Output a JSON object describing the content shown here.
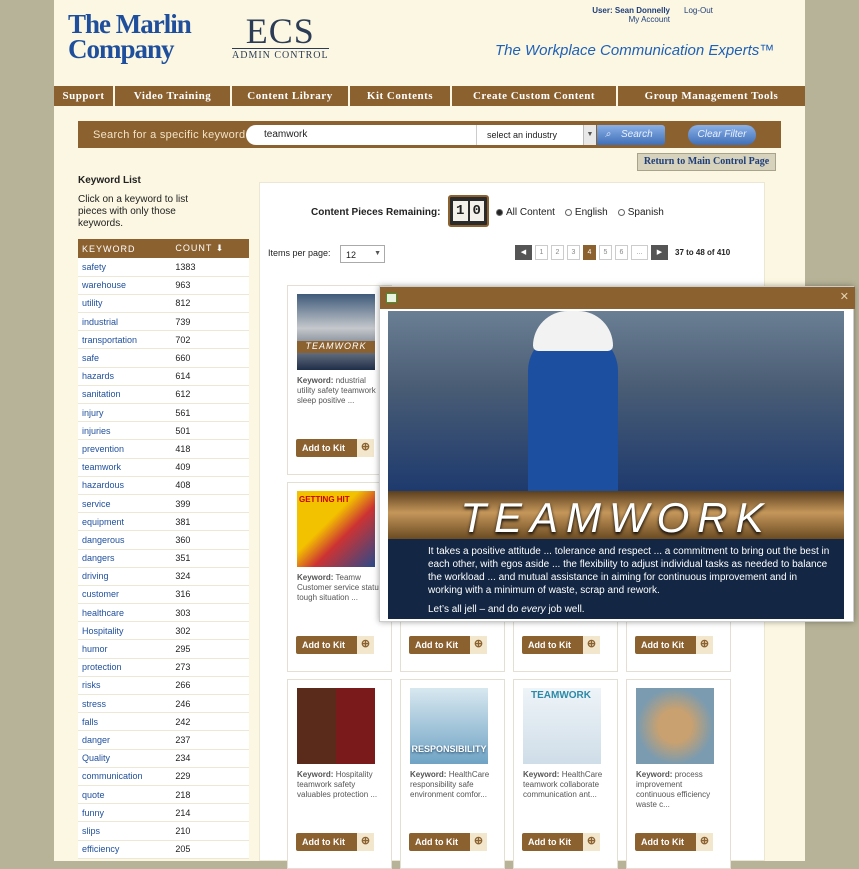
{
  "header": {
    "logo_marlin_line1": "The Marlin",
    "logo_marlin_line2": "Company",
    "logo_ecs": "ECS",
    "logo_ecs_sub": "ADMIN CONTROL",
    "user_label": "User: Sean Donnelly",
    "my_account": "My Account",
    "logout": "Log-Out",
    "tagline": "The Workplace Communication Experts™"
  },
  "nav": [
    "Support",
    "Video Training",
    "Content Library",
    "Kit Contents",
    "Create Custom Content",
    "Group Management Tools"
  ],
  "search": {
    "label": "Search for a specific keyword",
    "value": "teamwork",
    "industry": "select an industry",
    "search_button": "Search",
    "clear_button": "Clear Filter"
  },
  "return_button": "Return to Main Control Page",
  "keywords": {
    "title": "Keyword List",
    "description": "Click on a keyword to list pieces with only those keywords.",
    "col_keyword": "KEYWORD",
    "col_count": "COUNT ⬇",
    "rows": [
      [
        "safety",
        "1383"
      ],
      [
        "warehouse",
        "963"
      ],
      [
        "utility",
        "812"
      ],
      [
        "industrial",
        "739"
      ],
      [
        "transportation",
        "702"
      ],
      [
        "safe",
        "660"
      ],
      [
        "hazards",
        "614"
      ],
      [
        "sanitation",
        "612"
      ],
      [
        "injury",
        "561"
      ],
      [
        "injuries",
        "501"
      ],
      [
        "prevention",
        "418"
      ],
      [
        "teamwork",
        "409"
      ],
      [
        "hazardous",
        "408"
      ],
      [
        "service",
        "399"
      ],
      [
        "equipment",
        "381"
      ],
      [
        "dangerous",
        "360"
      ],
      [
        "dangers",
        "351"
      ],
      [
        "driving",
        "324"
      ],
      [
        "customer",
        "316"
      ],
      [
        "healthcare",
        "303"
      ],
      [
        "Hospitality",
        "302"
      ],
      [
        "humor",
        "295"
      ],
      [
        "protection",
        "273"
      ],
      [
        "risks",
        "266"
      ],
      [
        "stress",
        "246"
      ],
      [
        "falls",
        "242"
      ],
      [
        "danger",
        "237"
      ],
      [
        "Quality",
        "234"
      ],
      [
        "communication",
        "229"
      ],
      [
        "quote",
        "218"
      ],
      [
        "funny",
        "214"
      ],
      [
        "slips",
        "210"
      ],
      [
        "efficiency",
        "205"
      ]
    ]
  },
  "content": {
    "remaining_label": "Content Pieces Remaining:",
    "remaining_digits": [
      "1",
      "0"
    ],
    "filters": [
      "All Content",
      "English",
      "Spanish"
    ],
    "items_per_page_label": "Items per page:",
    "items_per_page": "12",
    "pages": [
      "1",
      "2",
      "3",
      "4",
      "5",
      "6",
      "..."
    ],
    "range_from": "37",
    "range_to": "to 48",
    "range_total": "of 410",
    "add_label": "Add to Kit",
    "keyword_label": "Keyword:",
    "cards": [
      {
        "title": "TEAMWORK",
        "keywords": "ndustrial utility safety teamwork sleep positive ..."
      },
      {
        "title": "GETTING HIT",
        "keywords": "Teamw Customer service status tough situation ..."
      },
      {
        "title": "",
        "keywords": ""
      },
      {
        "title": "",
        "keywords": ""
      },
      {
        "title": "",
        "keywords": ""
      },
      {
        "title": "",
        "keywords": ""
      },
      {
        "title": "",
        "keywords": "Hospitality teamwork safety valuables protection ..."
      },
      {
        "title": "RESPONSIBILITY",
        "keywords": "HealthCare responsibility safe environment comfor..."
      },
      {
        "title": "TEAMWORK",
        "keywords": "HealthCare teamwork collaborate communication ant..."
      },
      {
        "title": "",
        "keywords": "process improvement continuous efficiency waste c..."
      }
    ]
  },
  "popup": {
    "title": "TEAMWORK",
    "body": "It takes a positive attitude ... tolerance and respect ... a commitment to bring out the best in each other, with egos aside ... the flexibility to adjust individual tasks as needed to balance the workload ... and mutual assistance in aiming for continuous improvement and in working with a minimum of waste, scrap and rework.",
    "closing_pre": "Let’s all jell – and do ",
    "closing_em": "every",
    "closing_post": " job well."
  }
}
